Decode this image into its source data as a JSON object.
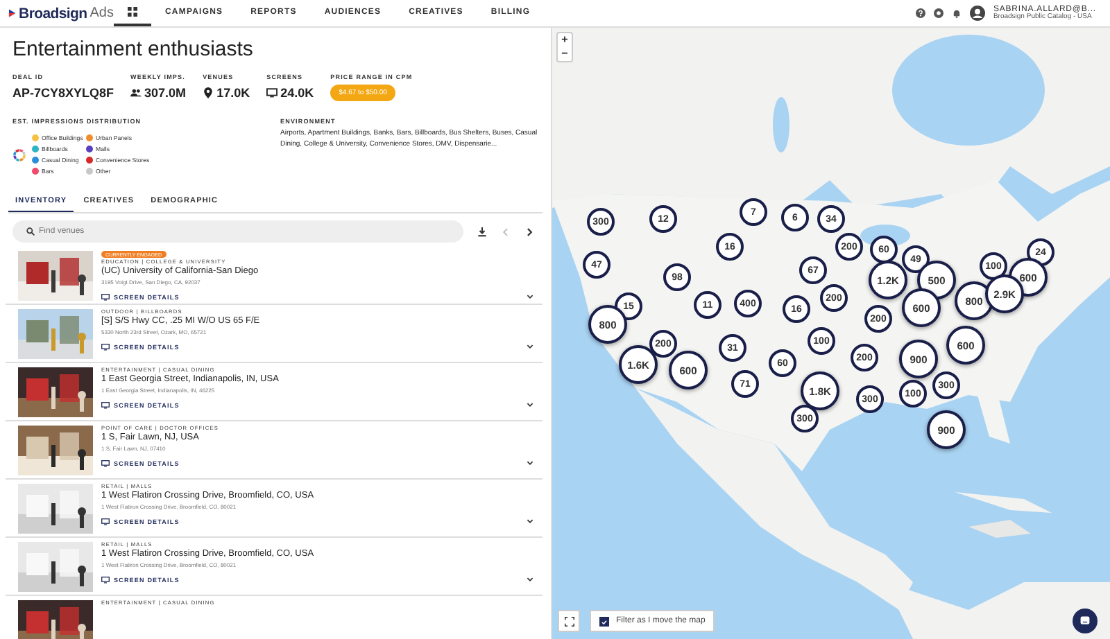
{
  "header": {
    "logo": "Broadsign",
    "logo_suffix": "Ads",
    "nav": [
      {
        "kind": "icon",
        "selected": true
      },
      {
        "label": "CAMPAIGNS",
        "selected": false
      },
      {
        "label": "REPORTS",
        "selected": false
      },
      {
        "label": "AUDIENCES",
        "selected": false
      },
      {
        "label": "CREATIVES",
        "selected": false
      },
      {
        "label": "BILLING",
        "selected": false
      }
    ],
    "user": {
      "name": "SABRINA.ALLARD@B...",
      "account": "Broadsign Public Catalog - USA"
    }
  },
  "title": "Entertainment enthusiasts",
  "stats": [
    {
      "label": "DEAL ID",
      "value": "AP-7CY8XYLQ8F",
      "kind": "text"
    },
    {
      "label": "WEEKLY IMPS.",
      "value": "307.0M",
      "kind": "people"
    },
    {
      "label": "VENUES",
      "value": "17.0K",
      "kind": "pin"
    },
    {
      "label": "SCREENS",
      "value": "24.0K",
      "kind": "screen"
    },
    {
      "label": "PRICE RANGE IN CPM",
      "value": "$4.67 to $50.00",
      "kind": "badge"
    }
  ],
  "distribution": {
    "label": "EST. IMPRESSIONS DISTRIBUTION",
    "items": [
      {
        "label": "Office Buildings",
        "color": "#f5c242"
      },
      {
        "label": "Urban Panels",
        "color": "#f08c2a"
      },
      {
        "label": "Billboards",
        "color": "#2cb5c4"
      },
      {
        "label": "Malls",
        "color": "#5a3fc0"
      },
      {
        "label": "Casual Dining",
        "color": "#2a8fd8"
      },
      {
        "label": "Convenience Stores",
        "color": "#d42a2a"
      },
      {
        "label": "Bars",
        "color": "#ef4b6b"
      },
      {
        "label": "Other",
        "color": "#c8c8c8"
      }
    ]
  },
  "environment": {
    "label": "ENVIRONMENT",
    "text": "Airports, Apartment Buildings, Banks, Bars, Billboards, Bus Shelters, Buses, Casual Dining, College & University, Convenience Stores, DMV, Dispensarie..."
  },
  "tabs": [
    {
      "label": "INVENTORY",
      "selected": true
    },
    {
      "label": "CREATIVES",
      "selected": false
    },
    {
      "label": "DEMOGRAPHIC",
      "selected": false
    }
  ],
  "search": {
    "placeholder": "Find venues"
  },
  "venues": [
    {
      "badge": "CURRENTLY ENGAGED",
      "category": "EDUCATION | COLLEGE & UNIVERSITY",
      "name": "(UC) University of California-San Diego",
      "address": "3195 Voigt Drive, San Diego, CA, 92037",
      "details": "SCREEN DETAILS"
    },
    {
      "category": "OUTDOOR | BILLBOARDS",
      "name": "[S] S/S Hwy CC, .25 MI W/O US 65 F/E",
      "address": "5330 North 23rd Street, Ozark, MO, 65721",
      "details": "SCREEN DETAILS"
    },
    {
      "category": "ENTERTAINMENT | CASUAL DINING",
      "name": "1 East Georgia Street, Indianapolis, IN, USA",
      "address": "1 East Georgia Street, Indianapolis, IN, 46225",
      "details": "SCREEN DETAILS"
    },
    {
      "category": "POINT OF CARE | DOCTOR OFFICES",
      "name": "1 S, Fair Lawn, NJ, USA",
      "address": "1 S, Fair Lawn, NJ, 07410",
      "details": "SCREEN DETAILS"
    },
    {
      "category": "RETAIL | MALLS",
      "name": "1 West Flatiron Crossing Drive, Broomfield, CO, USA",
      "address": "1 West Flatiron Crossing Drive, Broomfield, CO, 80021",
      "details": "SCREEN DETAILS"
    },
    {
      "category": "RETAIL | MALLS",
      "name": "1 West Flatiron Crossing Drive, Broomfield, CO, USA",
      "address": "1 West Flatiron Crossing Drive, Broomfield, CO, 80021",
      "details": "SCREEN DETAILS"
    },
    {
      "category": "ENTERTAINMENT | CASUAL DINING"
    }
  ],
  "map": {
    "kind": "picture",
    "zoom_in": "+",
    "zoom_out": "−",
    "filter": {
      "label": "Filter as I move the map",
      "checked": true
    },
    "clusters": [
      {
        "count": "300",
        "kind": "small"
      },
      {
        "count": "12",
        "kind": "small"
      },
      {
        "count": "7",
        "kind": "small"
      },
      {
        "count": "6",
        "kind": "small"
      },
      {
        "count": "34",
        "kind": "small"
      },
      {
        "count": "16",
        "kind": "small"
      },
      {
        "count": "200",
        "kind": "small"
      },
      {
        "count": "60",
        "kind": "small"
      },
      {
        "count": "49",
        "kind": "small"
      },
      {
        "count": "47",
        "kind": "small"
      },
      {
        "count": "98",
        "kind": "small"
      },
      {
        "count": "67",
        "kind": "small"
      },
      {
        "count": "100",
        "kind": "small"
      },
      {
        "count": "24",
        "kind": "small"
      },
      {
        "count": "1.2K",
        "kind": "large"
      },
      {
        "count": "500",
        "kind": "large"
      },
      {
        "count": "600",
        "kind": "large"
      },
      {
        "count": "15",
        "kind": "small"
      },
      {
        "count": "11",
        "kind": "small"
      },
      {
        "count": "400",
        "kind": "small"
      },
      {
        "count": "16",
        "kind": "small"
      },
      {
        "count": "200",
        "kind": "small"
      },
      {
        "count": "200",
        "kind": "small"
      },
      {
        "count": "600",
        "kind": "large"
      },
      {
        "count": "800",
        "kind": "large"
      },
      {
        "count": "2.9K",
        "kind": "large"
      },
      {
        "count": "800",
        "kind": "large"
      },
      {
        "count": "200",
        "kind": "small"
      },
      {
        "count": "31",
        "kind": "small"
      },
      {
        "count": "100",
        "kind": "small"
      },
      {
        "count": "1.6K",
        "kind": "large"
      },
      {
        "count": "600",
        "kind": "large"
      },
      {
        "count": "60",
        "kind": "small"
      },
      {
        "count": "200",
        "kind": "small"
      },
      {
        "count": "900",
        "kind": "large"
      },
      {
        "count": "600",
        "kind": "large"
      },
      {
        "count": "71",
        "kind": "small"
      },
      {
        "count": "1.8K",
        "kind": "large"
      },
      {
        "count": "300",
        "kind": "small"
      },
      {
        "count": "100",
        "kind": "small"
      },
      {
        "count": "300",
        "kind": "small"
      },
      {
        "count": "300",
        "kind": "small"
      },
      {
        "count": "900",
        "kind": "large"
      }
    ]
  }
}
